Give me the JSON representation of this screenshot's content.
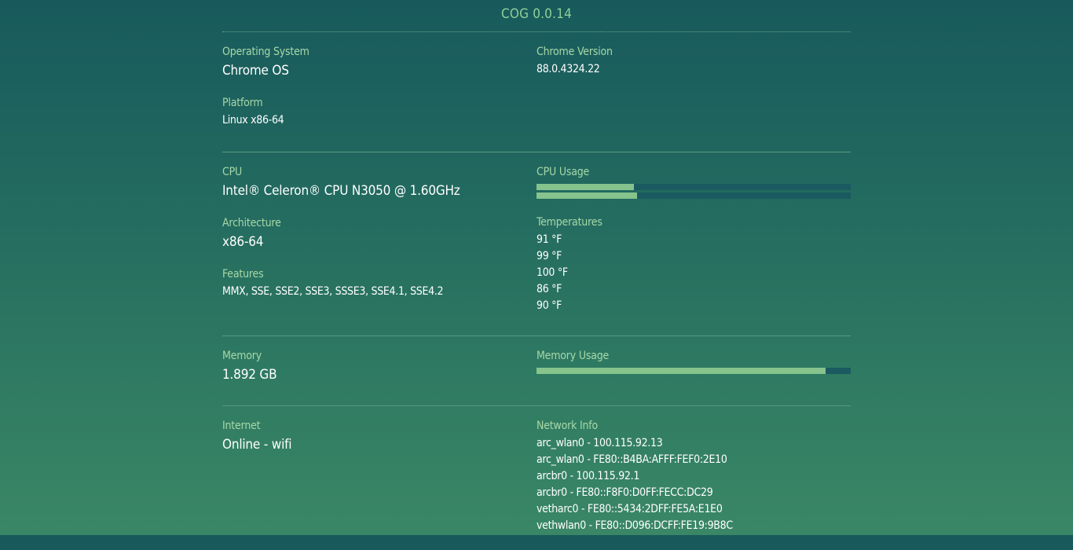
{
  "app_title": "COG 0.0.14",
  "system": {
    "os_label": "Operating System",
    "os_value": "Chrome OS",
    "chrome_label": "Chrome Version",
    "chrome_value": "88.0.4324.22",
    "platform_label": "Platform",
    "platform_value": "Linux x86-64"
  },
  "cpu": {
    "cpu_label": "CPU",
    "cpu_value": "Intel® Celeron® CPU N3050 @ 1.60GHz",
    "arch_label": "Architecture",
    "arch_value": "x86-64",
    "features_label": "Features",
    "features_value": "MMX, SSE, SSE2, SSE3, SSSE3, SSE4.1, SSE4.2",
    "usage_label": "CPU Usage",
    "usage": [
      0.31,
      0.32
    ],
    "temps_label": "Temperatures",
    "temps": [
      "91 °F",
      "99 °F",
      "100 °F",
      "86 °F",
      "90 °F"
    ]
  },
  "memory": {
    "memory_label": "Memory",
    "memory_value": "1.892 GB",
    "usage_label": "Memory Usage",
    "usage": 0.92
  },
  "network": {
    "internet_label": "Internet",
    "internet_value": "Online - wifi",
    "info_label": "Network Info",
    "interfaces": [
      "arc_wlan0 - 100.115.92.13",
      "arc_wlan0 - FE80::B4BA:AFFF:FEF0:2E10",
      "arcbr0 - 100.115.92.1",
      "arcbr0 - FE80::F8F0:D0FF:FECC:DC29",
      "vetharc0 - FE80::5434:2DFF:FE5A:E1E0",
      "vethwlan0 - FE80::D096:DCFF:FE19:9B8C"
    ]
  },
  "colors": {
    "accent": "#86c38d",
    "bar_track": "#1a5a60",
    "label": "#a7d8a8"
  }
}
